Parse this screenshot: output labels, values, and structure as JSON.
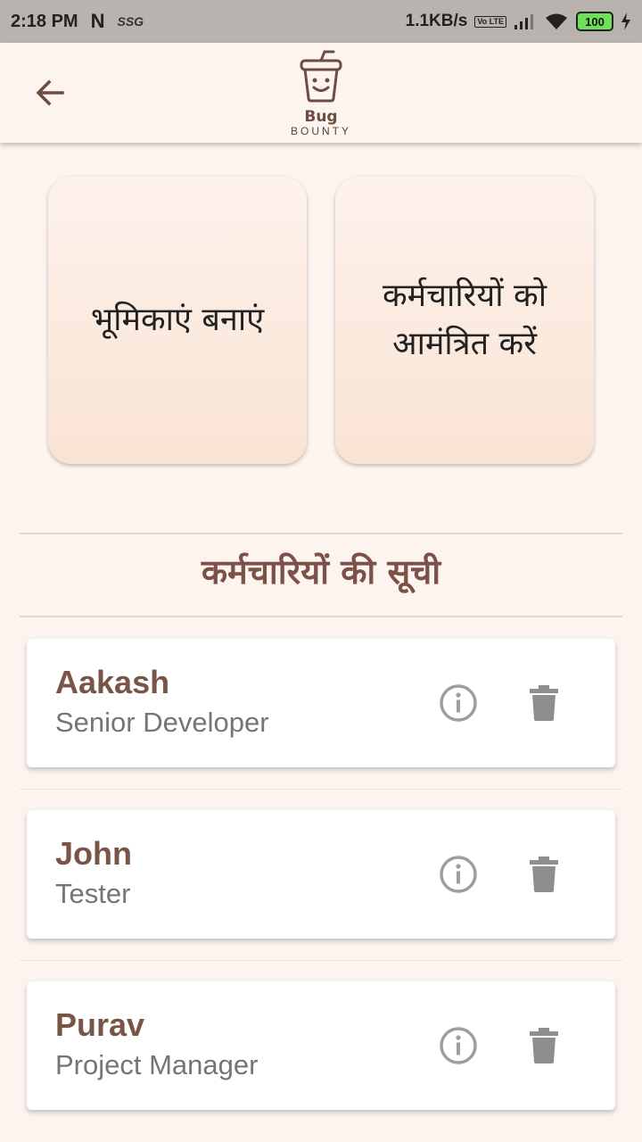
{
  "status_bar": {
    "time": "2:18 PM",
    "notif_n": "N",
    "notif_ssg": "SSG",
    "net_speed": "1.1KB/s",
    "volte": "Vo LTE",
    "battery": "100"
  },
  "app_bar": {
    "back_icon": "arrow-left-icon",
    "logo_line1": "Bug",
    "logo_line2": "BOUNTY"
  },
  "actions": {
    "create_roles": "भूमिकाएं बनाएं",
    "invite_employees": "कर्मचारियों को आमंत्रित करें"
  },
  "employee_list": {
    "title": "कर्मचारियों की सूची",
    "employees": [
      {
        "name": "Aakash",
        "role": "Senior Developer"
      },
      {
        "name": "John",
        "role": "Tester"
      },
      {
        "name": "Purav",
        "role": "Project Manager"
      }
    ]
  },
  "icons": {
    "info": "info-icon",
    "delete": "trash-icon"
  },
  "colors": {
    "accent": "#795548",
    "background": "#fdf4ef",
    "status_bar": "#b8b3af"
  }
}
